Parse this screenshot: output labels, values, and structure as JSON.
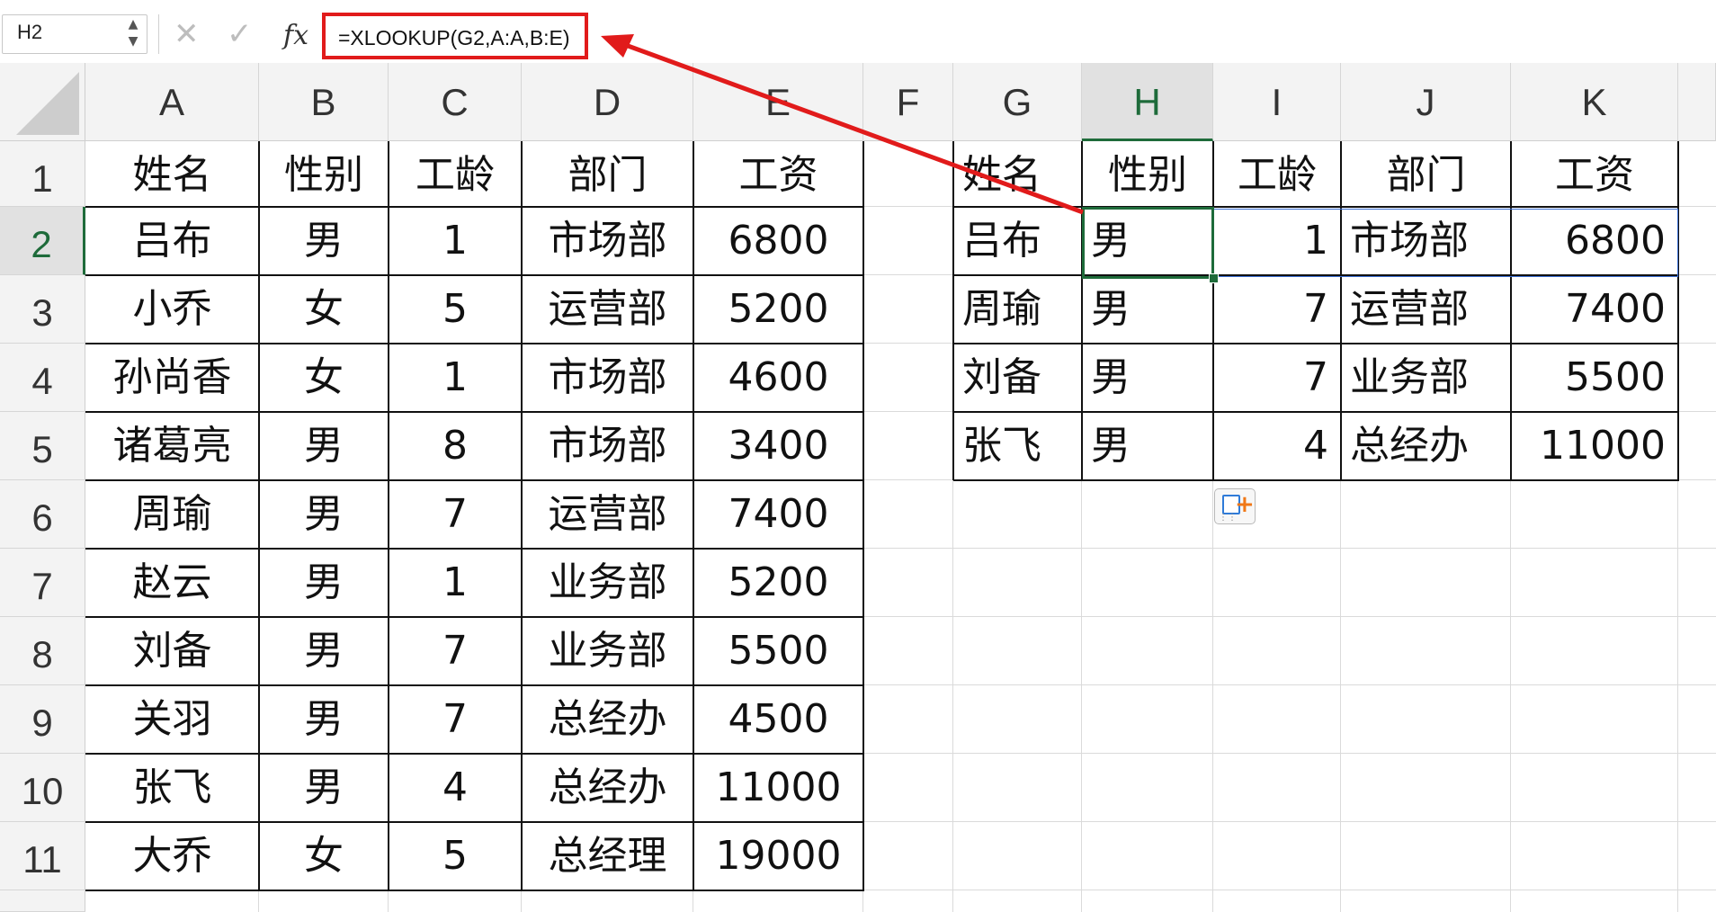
{
  "formula_bar": {
    "name_box": "H2",
    "cancel_icon": "✕",
    "confirm_icon": "✓",
    "fx_icon": "fx",
    "formula": "=XLOOKUP(G2,A:A,B:E)"
  },
  "columns": [
    "A",
    "B",
    "C",
    "D",
    "E",
    "F",
    "G",
    "H",
    "I",
    "J",
    "K"
  ],
  "rows": [
    "1",
    "2",
    "3",
    "4",
    "5",
    "6",
    "7",
    "8",
    "9",
    "10",
    "11"
  ],
  "selected_cell": "H2",
  "source_table": {
    "headers": [
      "姓名",
      "性别",
      "工龄",
      "部门",
      "工资"
    ],
    "rows": [
      [
        "吕布",
        "男",
        "1",
        "市场部",
        "6800"
      ],
      [
        "小乔",
        "女",
        "5",
        "运营部",
        "5200"
      ],
      [
        "孙尚香",
        "女",
        "1",
        "市场部",
        "4600"
      ],
      [
        "诸葛亮",
        "男",
        "8",
        "市场部",
        "3400"
      ],
      [
        "周瑜",
        "男",
        "7",
        "运营部",
        "7400"
      ],
      [
        "赵云",
        "男",
        "1",
        "业务部",
        "5200"
      ],
      [
        "刘备",
        "男",
        "7",
        "业务部",
        "5500"
      ],
      [
        "关羽",
        "男",
        "7",
        "总经办",
        "4500"
      ],
      [
        "张飞",
        "男",
        "4",
        "总经办",
        "11000"
      ],
      [
        "大乔",
        "女",
        "5",
        "总经理",
        "19000"
      ]
    ]
  },
  "lookup_table": {
    "headers": [
      "姓名",
      "性别",
      "工龄",
      "部门",
      "工资"
    ],
    "rows": [
      [
        "吕布",
        "男",
        "1",
        "市场部",
        "6800"
      ],
      [
        "周瑜",
        "男",
        "7",
        "运营部",
        "7400"
      ],
      [
        "刘备",
        "男",
        "7",
        "业务部",
        "5500"
      ],
      [
        "张飞",
        "男",
        "4",
        "总经办",
        "11000"
      ]
    ]
  },
  "annotation": {
    "color": "#e11b1b",
    "icon": "arrow-icon"
  },
  "paste_options": {
    "icon": "paste-options-icon"
  }
}
